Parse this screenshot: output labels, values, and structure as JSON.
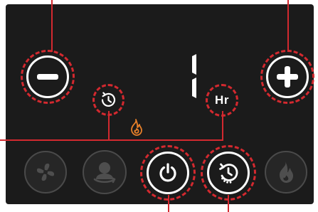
{
  "display": {
    "value": "1",
    "unit_label": "Hr"
  },
  "buttons": {
    "decrease": {
      "icon": "minus-icon"
    },
    "increase": {
      "icon": "plus-icon"
    },
    "timer_indicator": {
      "icon": "clock-icon"
    },
    "power": {
      "icon": "power-icon"
    },
    "timer": {
      "icon": "timer-icon"
    },
    "fan": {
      "icon": "fan-icon",
      "state": "dim"
    },
    "heat_mode": {
      "icon": "person-heat-icon",
      "state": "dim"
    },
    "flame": {
      "icon": "flame-icon",
      "state": "dim"
    }
  },
  "indicators": {
    "flame": {
      "icon": "flame-icon",
      "color": "#e8802a"
    }
  },
  "colors": {
    "callout": "#d3292f",
    "panel": "#1b1b1b",
    "active": "#ffffff",
    "inactive": "#4a4a4a",
    "flame": "#e8802a"
  }
}
